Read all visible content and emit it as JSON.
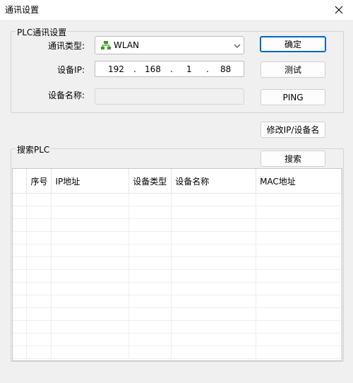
{
  "window": {
    "title": "通讯设置"
  },
  "plc_group": {
    "label": "PLC通讯设置",
    "comm_type_label": "通讯类型:",
    "comm_type_value": "WLAN",
    "comm_type_icon": "network-icon",
    "ip_label": "设备IP:",
    "ip": [
      "192",
      "168",
      "1",
      "88"
    ],
    "ip_dot": ".",
    "name_label": "设备名称:",
    "name_value": ""
  },
  "buttons": {
    "ok": "确定",
    "test": "测试",
    "ping": "PING",
    "modify": "修改IP/设备名",
    "search": "搜索"
  },
  "search_group": {
    "label": "搜索PLC"
  },
  "table": {
    "columns": [
      "",
      "序号",
      "IP地址",
      "设备类型",
      "设备名称",
      "MAC地址"
    ],
    "rows": []
  },
  "colors": {
    "accent": "#0067c0",
    "background": "#f0f0f0",
    "network_icon": "#3c9a2b"
  }
}
